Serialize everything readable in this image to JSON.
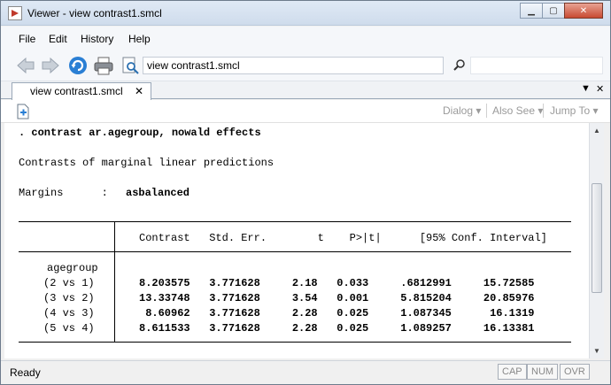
{
  "window": {
    "title": "Viewer - view contrast1.smcl"
  },
  "menu": {
    "items": [
      "File",
      "Edit",
      "History",
      "Help"
    ]
  },
  "toolbar": {
    "address_value": "view contrast1.smcl"
  },
  "tab": {
    "label": "view contrast1.smcl",
    "close_glyph": "✕"
  },
  "content_toolbar": {
    "dialog": "Dialog ▾",
    "also_see": "Also See ▾",
    "jump_to": "Jump To ▾"
  },
  "results": {
    "command": ". contrast ar.agegroup, nowald effects",
    "heading": "Contrasts of marginal linear predictions",
    "margins_label": "Margins      :",
    "margins_value": "asbalanced",
    "header_cols": "Contrast   Std. Err.        t    P>|t|      [95% Conf. Interval]",
    "row_label": "agegroup",
    "rows": [
      {
        "label": "(2 vs 1)",
        "values": "8.203575   3.771628     2.18   0.033     .6812991     15.72585"
      },
      {
        "label": "(3 vs 2)",
        "values": "13.33748   3.771628     3.54   0.001     5.815204     20.85976"
      },
      {
        "label": "(4 vs 3)",
        "values": " 8.60962   3.771628     2.28   0.025     1.087345      16.1319"
      },
      {
        "label": "(5 vs 4)",
        "values": "8.611533   3.771628     2.28   0.025     1.089257     16.13381"
      }
    ]
  },
  "status": {
    "text": "Ready",
    "cap": "CAP",
    "num": "NUM",
    "ovr": "OVR"
  }
}
